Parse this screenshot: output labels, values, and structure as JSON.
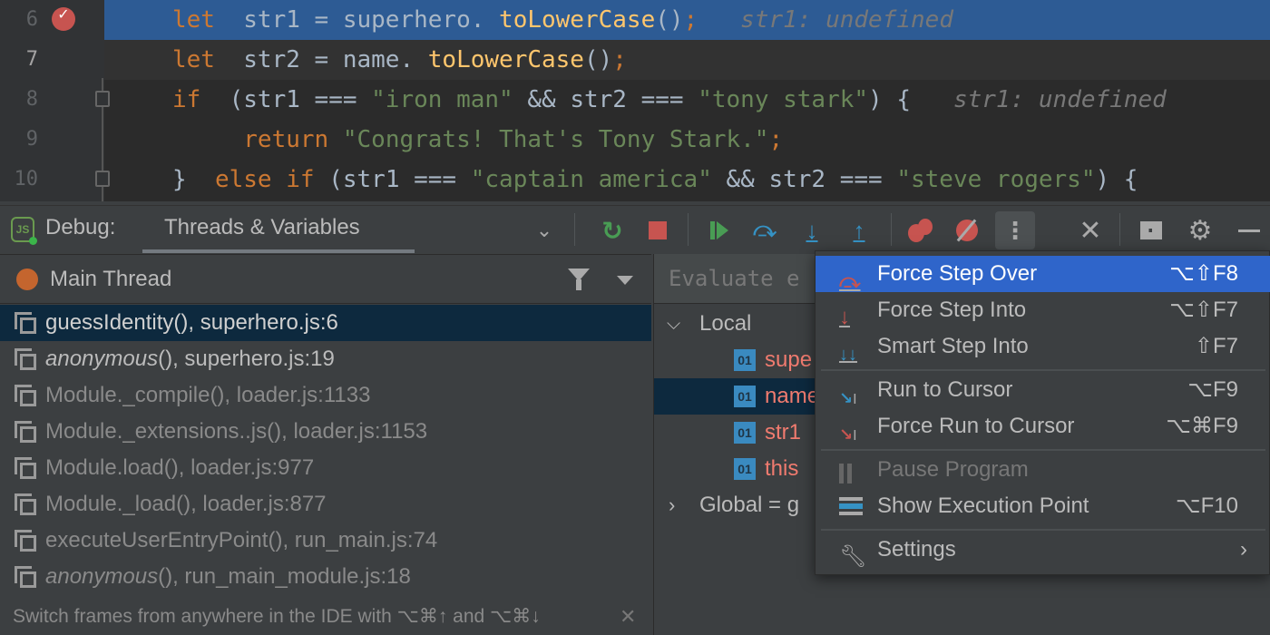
{
  "editor": {
    "lines": [
      {
        "num": "6",
        "tokens": [
          [
            "kw",
            "let"
          ],
          [
            "",
            "str1 = superhero."
          ],
          [
            "fn",
            "toLowerCase"
          ],
          [
            "",
            "()"
          ],
          [
            "kw",
            ";"
          ],
          [
            "",
            "   "
          ],
          [
            "hint",
            "str1: undefined"
          ]
        ]
      },
      {
        "num": "7",
        "tokens": [
          [
            "kw",
            "let"
          ],
          [
            "",
            "str2 = name."
          ],
          [
            "fn",
            "toLowerCase"
          ],
          [
            "",
            "()"
          ],
          [
            "kw",
            ";"
          ]
        ]
      },
      {
        "num": "8",
        "tokens": [
          [
            "kw",
            "if"
          ],
          [
            "",
            " (str1 === "
          ],
          [
            "str",
            "\"iron man\""
          ],
          [
            "",
            " && str2 === "
          ],
          [
            "str",
            "\"tony stark\""
          ],
          [
            "",
            ") {   "
          ],
          [
            "hint",
            "str1: undefined"
          ]
        ]
      },
      {
        "num": "9",
        "tokens": [
          [
            "",
            "    "
          ],
          [
            "kw",
            "return"
          ],
          [
            "",
            " "
          ],
          [
            "str",
            "\"Congrats! That's Tony Stark.\""
          ],
          [
            "kw",
            ";"
          ]
        ]
      },
      {
        "num": "10",
        "tokens": [
          [
            "",
            "} "
          ],
          [
            "kw",
            "else if"
          ],
          [
            "",
            " (str1 === "
          ],
          [
            "str",
            "\"captain america\""
          ],
          [
            "",
            " && str2 === "
          ],
          [
            "str",
            "\"steve rogers\""
          ],
          [
            "",
            ") {"
          ]
        ]
      }
    ]
  },
  "toolbar": {
    "title": "Debug:",
    "tab": "Threads & Variables"
  },
  "threads": {
    "current": "Main Thread",
    "frames": [
      {
        "name": "guessIdentity",
        "italic": false,
        "rest": "(), superhero.js:6",
        "dim": false,
        "selected": true
      },
      {
        "name": "anonymous",
        "italic": true,
        "rest": "(), superhero.js:19",
        "dim": false
      },
      {
        "name": "Module._compile",
        "italic": false,
        "rest": "(), loader.js:1133",
        "dim": true
      },
      {
        "name": "Module._extensions..js",
        "italic": false,
        "rest": "(), loader.js:1153",
        "dim": true
      },
      {
        "name": "Module.load",
        "italic": false,
        "rest": "(), loader.js:977",
        "dim": true
      },
      {
        "name": "Module._load",
        "italic": false,
        "rest": "(), loader.js:877",
        "dim": true
      },
      {
        "name": "executeUserEntryPoint",
        "italic": false,
        "rest": "(), run_main.js:74",
        "dim": true
      },
      {
        "name": "anonymous",
        "italic": true,
        "rest": "(), run_main_module.js:18",
        "dim": true
      }
    ],
    "hint": "Switch frames from anywhere in the IDE with ⌥⌘↑ and ⌥⌘↓"
  },
  "variables": {
    "evaluate_placeholder": "Evaluate e",
    "local": "Local",
    "badge": "01",
    "vars": [
      "supe",
      "name",
      "str1",
      "this"
    ],
    "global": "Global = g"
  },
  "menu": {
    "items": [
      {
        "label": "Force Step Over",
        "shortcut": "⌥⇧F8"
      },
      {
        "label": "Force Step Into",
        "shortcut": "⌥⇧F7"
      },
      {
        "label": "Smart Step Into",
        "shortcut": "⇧F7"
      },
      {
        "label": "Run to Cursor",
        "shortcut": "⌥F9"
      },
      {
        "label": "Force Run to Cursor",
        "shortcut": "⌥⌘F9"
      },
      {
        "label": "Pause Program",
        "shortcut": ""
      },
      {
        "label": "Show Execution Point",
        "shortcut": "⌥F10"
      },
      {
        "label": "Settings",
        "shortcut": "›"
      }
    ]
  },
  "colors": {
    "selection": "#2f65ca",
    "current_line": "#2d5b94",
    "frame_selected": "#0d293e"
  }
}
